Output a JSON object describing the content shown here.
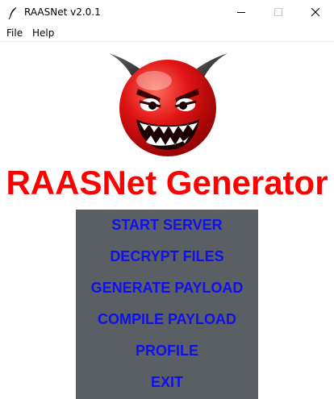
{
  "window": {
    "title": "RAASNet v2.0.1"
  },
  "menu": {
    "items": [
      "File",
      "Help"
    ]
  },
  "heading": "RAASNet Generator",
  "buttons": [
    "START SERVER",
    "DECRYPT FILES",
    "GENERATE PAYLOAD",
    "COMPILE PAYLOAD",
    "PROFILE",
    "EXIT"
  ],
  "colors": {
    "heading": "#ff0000",
    "button_text": "#1010ee",
    "panel": "#5a5f64"
  },
  "icons": {
    "app": "feather-icon",
    "logo": "devil-smiley-logo"
  }
}
